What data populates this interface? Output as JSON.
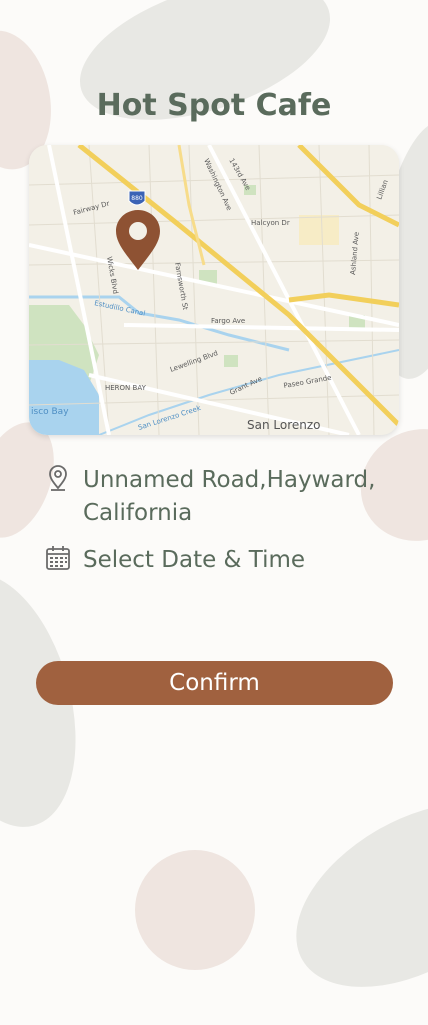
{
  "title": "Hot Spot Cafe",
  "map": {
    "labels": {
      "fairway": "Fairway Dr",
      "washington": "Washington Ave",
      "st143": "143rd Ave",
      "halcyon": "Halcyon Dr",
      "wicks": "Wicks Blvd",
      "farnsworth": "Farnsworth St",
      "estudillo": "Estudillo Canal",
      "fargo": "Fargo Ave",
      "lewelling": "Lewelling Blvd",
      "grant": "Grant Ave",
      "paseo": "Paseo Grande",
      "ashland": "Ashland Ave",
      "heron": "HERON BAY",
      "sanlorenzocreek": "San Lorenzo Creek",
      "bay": "isco Bay",
      "sanlorenzo": "San Lorenzo",
      "lillian": "Lillian",
      "shield": "880"
    }
  },
  "address": "Unnamed Road,Hayward, California",
  "datetime": "Select Date & Time",
  "confirm": "Confirm",
  "icons": {
    "location": "map-pin-icon",
    "calendar": "calendar-icon"
  },
  "colors": {
    "accent": "#a0613f",
    "text": "#5a6b5c"
  }
}
